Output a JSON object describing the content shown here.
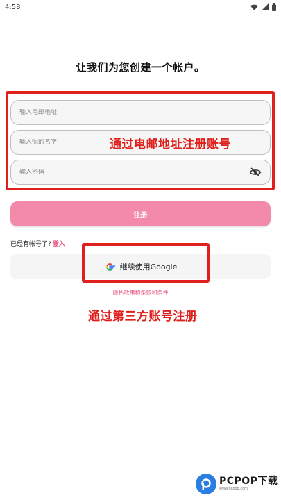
{
  "status_bar": {
    "time": "4:58"
  },
  "page": {
    "title": "让我们为您创建一个帐户。"
  },
  "form": {
    "email_placeholder": "输入电邮地址",
    "name_placeholder": "输入你的名字",
    "password_placeholder": "输入密码"
  },
  "annotations": {
    "email_register": "通过电邮地址注册账号",
    "third_party_register": "通过第三方账号注册"
  },
  "buttons": {
    "register_label": "注册",
    "google_label": "继续使用Google"
  },
  "login_prompt": {
    "text": "已经有帐号了?",
    "link": "登入"
  },
  "privacy": {
    "text": "隐私政策和条款和条件"
  },
  "watermark": {
    "brand": "PCPOP下载",
    "sub": "www.pcpop.com"
  },
  "colors": {
    "accent_pink": "#f48aa9",
    "link_pink": "#e8577e",
    "annotation_red": "#e0201c"
  },
  "icons": [
    "wifi-icon",
    "signal-icon",
    "battery-icon",
    "eye-off-icon",
    "google-icon"
  ]
}
